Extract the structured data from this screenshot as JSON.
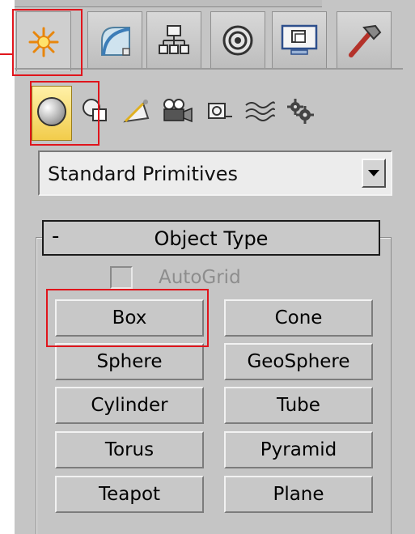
{
  "command_panel": {
    "tabs": [
      {
        "name": "create",
        "icon": "create-sparkle-icon",
        "active": true
      },
      {
        "name": "modify",
        "icon": "modify-arc-icon",
        "active": false
      },
      {
        "name": "hierarchy",
        "icon": "hierarchy-icon",
        "active": false
      },
      {
        "name": "motion",
        "icon": "motion-circle-icon",
        "active": false
      },
      {
        "name": "display",
        "icon": "display-monitor-icon",
        "active": false
      },
      {
        "name": "utilities",
        "icon": "utilities-hammer-icon",
        "active": false
      }
    ],
    "categories": [
      {
        "name": "geometry",
        "icon": "sphere-icon",
        "active": true
      },
      {
        "name": "shapes",
        "icon": "shapes-icon",
        "active": false
      },
      {
        "name": "lights",
        "icon": "light-icon",
        "active": false
      },
      {
        "name": "cameras",
        "icon": "camera-icon",
        "active": false
      },
      {
        "name": "helpers",
        "icon": "helper-tape-icon",
        "active": false
      },
      {
        "name": "space-warps",
        "icon": "space-warp-icon",
        "active": false
      },
      {
        "name": "systems",
        "icon": "systems-gear-icon",
        "active": false
      }
    ]
  },
  "dropdown": {
    "selected": "Standard Primitives"
  },
  "rollout": {
    "collapse_symbol": "-",
    "title": "Object Type",
    "autogrid_label": "AutoGrid",
    "autogrid_checked": false,
    "buttons": [
      [
        "Box",
        "Cone"
      ],
      [
        "Sphere",
        "GeoSphere"
      ],
      [
        "Cylinder",
        "Tube"
      ],
      [
        "Torus",
        "Pyramid"
      ],
      [
        "Teapot",
        "Plane"
      ]
    ]
  },
  "colors": {
    "highlight": "#e0151c",
    "panel": "#c5c5c5",
    "active_category": "#f2cc4b"
  }
}
